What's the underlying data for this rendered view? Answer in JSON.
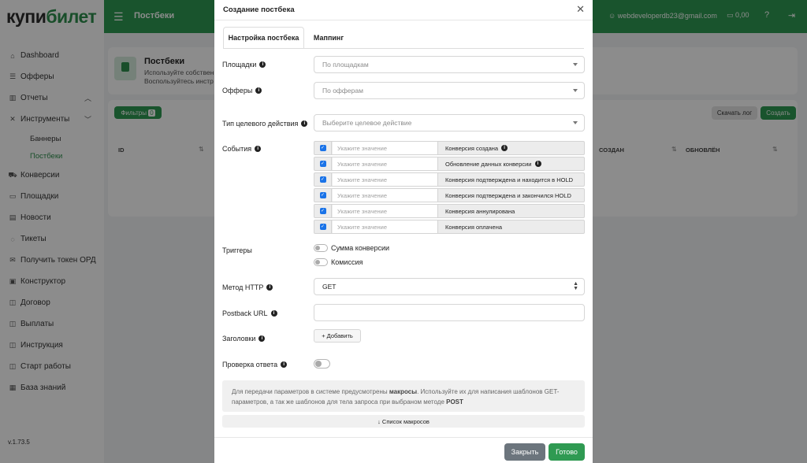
{
  "app": {
    "logo_part1": "купи",
    "logo_part2": "билет",
    "version": "v.1.73.5"
  },
  "sidebar": {
    "items": [
      {
        "label": "Dashboard",
        "icon": "⌂"
      },
      {
        "label": "Офферы",
        "icon": "☰"
      },
      {
        "label": "Отчеты",
        "icon": "▥"
      },
      {
        "label": "Инструменты",
        "icon": "✕"
      },
      {
        "label": "Конверсии",
        "icon": "⛟"
      },
      {
        "label": "Площадки",
        "icon": "▭"
      },
      {
        "label": "Новости",
        "icon": "▤"
      },
      {
        "label": "Тикеты",
        "icon": "◌"
      },
      {
        "label": "Получить токен ОРД",
        "icon": "✉"
      },
      {
        "label": "Конструктор",
        "icon": "▣"
      },
      {
        "label": "Договор",
        "icon": "◫"
      },
      {
        "label": "Выплаты",
        "icon": "◫"
      },
      {
        "label": "Инструкция",
        "icon": "◫"
      },
      {
        "label": "Старт работы",
        "icon": "◫"
      },
      {
        "label": "База знаний",
        "icon": "▦"
      }
    ],
    "sub_items": [
      {
        "label": "Баннеры"
      },
      {
        "label": "Постбеки"
      }
    ]
  },
  "topbar": {
    "title": "Постбеки",
    "email": "webdeveloperdb23@gmail.com",
    "balance": "0,00"
  },
  "background": {
    "page_title": "Постбеки",
    "sub1": "Используйте собствен",
    "sub2": "Воспользуйтесь инстр",
    "filters_label": "Фильтры",
    "filters_count": "0",
    "download_log": "Скачать лог",
    "create": "Создать",
    "col_id": "ID",
    "col_created": "СОЗДАН",
    "col_updated": "ОБНОВЛЁН"
  },
  "modal": {
    "title": "Создание постбека",
    "tabs": [
      {
        "label": "Настройка постбека"
      },
      {
        "label": "Маппинг"
      }
    ],
    "fields": {
      "platforms_label": "Площадки",
      "platforms_placeholder": "По площадкам",
      "offers_label": "Офферы",
      "offers_placeholder": "По офферам",
      "target_action_label": "Тип целевого действия",
      "target_action_placeholder": "Выберите целевое действие",
      "events_label": "События",
      "triggers_label": "Триггеры",
      "http_method_label": "Метод HTTP",
      "http_method_value": "GET",
      "postback_url_label": "Postback URL",
      "headers_label": "Заголовки",
      "add_button": "+ Добавить",
      "check_response_label": "Проверка ответа"
    },
    "events": [
      {
        "placeholder": "Укажите значение",
        "name": "Конверсия создана",
        "info": true
      },
      {
        "placeholder": "Укажите значение",
        "name": "Обновление данных конверсии",
        "info": true
      },
      {
        "placeholder": "Укажите значение",
        "name": "Конверсия подтверждена и находится в HOLD",
        "info": false
      },
      {
        "placeholder": "Укажите значение",
        "name": "Конверсия подтверждена и закончился HOLD",
        "info": false
      },
      {
        "placeholder": "Укажите значение",
        "name": "Конверсия аннулирована",
        "info": false
      },
      {
        "placeholder": "Укажите значение",
        "name": "Конверсия оплачена",
        "info": false
      }
    ],
    "triggers": [
      {
        "label": "Сумма конверсии"
      },
      {
        "label": "Комиссия"
      }
    ],
    "info": {
      "part1": "Для передачи параметров в системе предусмотрены ",
      "bold1": "макросы",
      "part2": ". Используйте их для написания шаблонов GET-параметров, а так же шаблонов для тела запроса при выбраном методе ",
      "bold2": "POST"
    },
    "macro_list_button": "↓ Список макросов",
    "close_button": "Закрыть",
    "done_button": "Готово"
  }
}
